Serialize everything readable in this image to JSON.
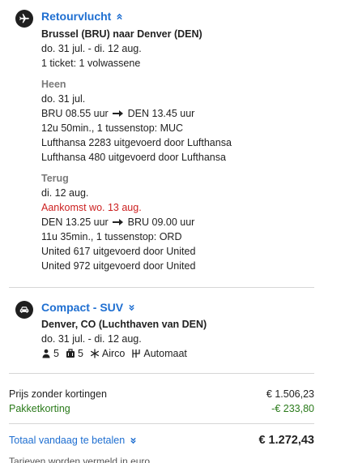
{
  "flight": {
    "icon": "airplane-icon",
    "title": "Retourvlucht",
    "route": "Brussel (BRU) naar Denver (DEN)",
    "dates": "do. 31 jul. - di. 12 aug.",
    "tickets": "1 ticket: 1 volwassene",
    "outbound": {
      "label": "Heen",
      "date": "do. 31 jul.",
      "dep": "BRU 08.55 uur",
      "arr": "DEN 13.45 uur",
      "duration": "12u 50min., 1 tussenstop: MUC",
      "segments": [
        "Lufthansa 2283 uitgevoerd door Lufthansa",
        "Lufthansa 480 uitgevoerd door Lufthansa"
      ]
    },
    "return": {
      "label": "Terug",
      "date": "di. 12 aug.",
      "arrival_note": "Aankomst wo. 13 aug.",
      "dep": "DEN 13.25 uur",
      "arr": "BRU 09.00 uur",
      "duration": "11u 35min., 1 tussenstop: ORD",
      "segments": [
        "United 617 uitgevoerd door United",
        "United 972 uitgevoerd door United"
      ]
    }
  },
  "car": {
    "icon": "car-icon",
    "title": "Compact - SUV",
    "location": "Denver, CO (Luchthaven van DEN)",
    "dates": "do. 31 jul. - di. 12 aug.",
    "amenities": {
      "passengers": "5",
      "bags": "5",
      "aircon": "Airco",
      "transmission": "Automaat"
    }
  },
  "pricing": {
    "base_label": "Prijs zonder kortingen",
    "base_value": "€ 1.506,23",
    "discount_label": "Pakketkorting",
    "discount_value": "-€ 233,80",
    "total_label": "Totaal vandaag te betalen",
    "total_value": "€ 1.272,43",
    "footnote": "Tarieven worden vermeld in euro"
  },
  "colors": {
    "link": "#1f6fd1",
    "discount": "#2a7a1a",
    "alert": "#cc1f1f"
  }
}
